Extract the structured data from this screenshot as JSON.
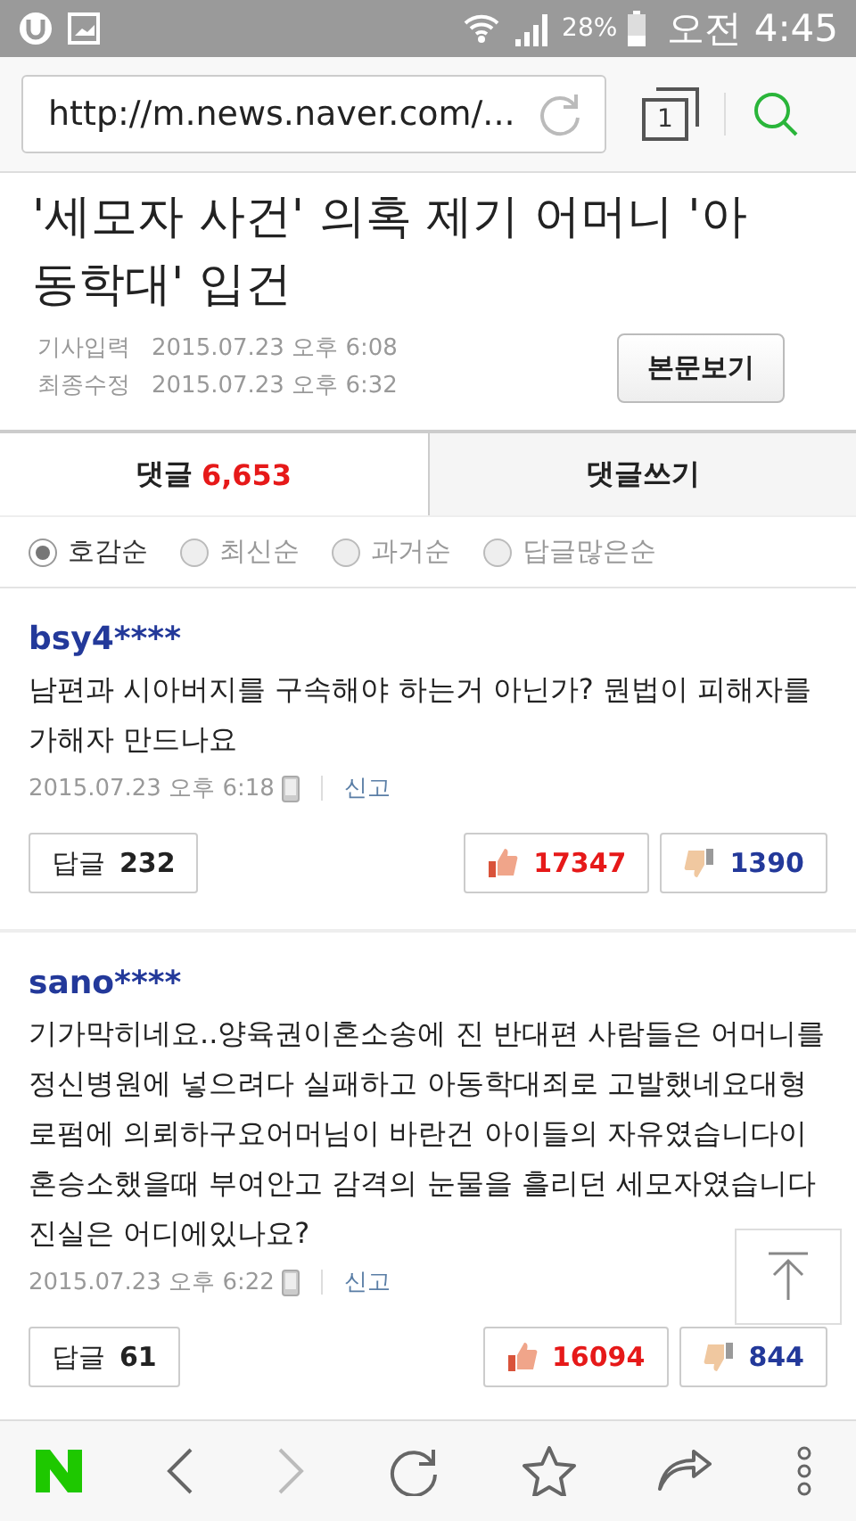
{
  "status_bar": {
    "battery": "28%",
    "time": "오전 4:45"
  },
  "address_bar": {
    "url": "http://m.news.naver.com/...",
    "tab_count": "1"
  },
  "article": {
    "title": "'세모자 사건' 의혹 제기 어머니 '아동학대' 입건",
    "meta": [
      {
        "label": "기사입력",
        "value": "2015.07.23 오후 6:08"
      },
      {
        "label": "최종수정",
        "value": "2015.07.23 오후 6:32"
      }
    ],
    "view_button": "본문보기"
  },
  "tabs": [
    {
      "label": "댓글",
      "count": "6,653",
      "selected": true
    },
    {
      "label": "댓글쓰기",
      "selected": false
    }
  ],
  "sort_options": [
    {
      "label": "호감순",
      "selected": true
    },
    {
      "label": "최신순",
      "selected": false
    },
    {
      "label": "과거순",
      "selected": false
    },
    {
      "label": "답글많은순",
      "selected": false
    }
  ],
  "comments": [
    {
      "user": "bsy4****",
      "text": "남편과 시아버지를 구속해야 하는거 아닌가? 뭔법이 피해자를 가해자 만드나요",
      "time": "2015.07.23 오후 6:18",
      "report": "신고",
      "reply_label": "답글",
      "replies": "232",
      "likes": "17347",
      "dislikes": "1390"
    },
    {
      "user": "sano****",
      "text": "기가막히네요..양육권이혼소송에 진 반대편 사람들은 어머니를 정신병원에 넣으려다 실패하고 아동학대죄로 고발했네요대형로펌에 의뢰하구요어머님이 바란건 아이들의 자유였습니다이혼승소했을때 부여안고 감격의 눈물을 흘리던 세모자였습니다 진실은 어디에있나요?",
      "time": "2015.07.23 오후 6:22",
      "report": "신고",
      "reply_label": "답글",
      "replies": "61",
      "likes": "16094",
      "dislikes": "844"
    }
  ]
}
